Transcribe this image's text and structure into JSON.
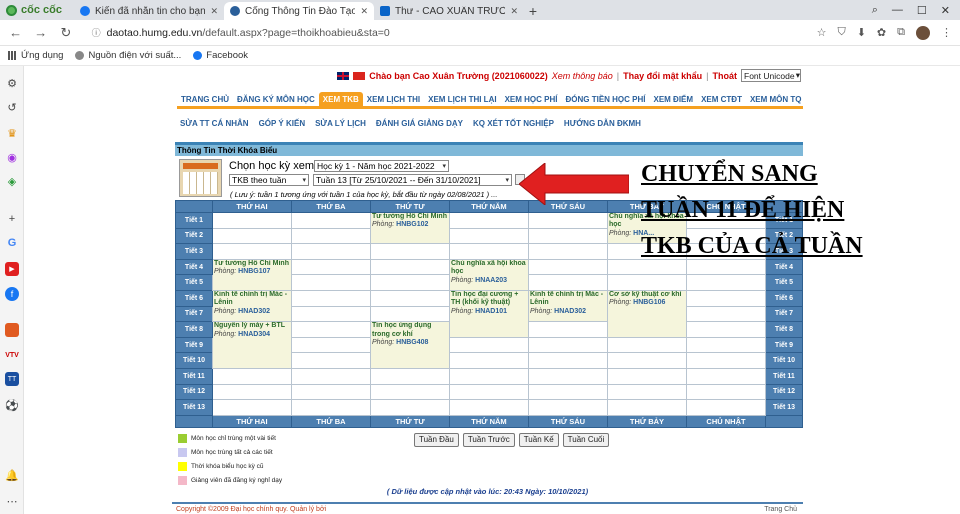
{
  "browser": {
    "brand": "cốc cốc",
    "tabs": [
      {
        "title": "Kiến đã nhắn tin cho bạn",
        "active": false
      },
      {
        "title": "Cổng Thông Tin Đào Tạo-Đạ",
        "active": true
      },
      {
        "title": "Thư - CAO XUÂN TRƯỜNG - ...",
        "active": false
      }
    ],
    "url_host": "daotao.humg.edu.vn",
    "url_path": "/default.aspx?page=thoikhoabieu&sta=0",
    "bookmarks": [
      "Ứng dụng",
      "Nguồn điện với suất...",
      "Facebook"
    ]
  },
  "header": {
    "greeting": "Chào bạn Cao Xuân Trường (2021060022)",
    "notice": "Xem thông báo",
    "change_password": "Thay đổi mật khẩu",
    "logout": "Thoát",
    "font_select": "Font Unicode"
  },
  "menu_primary": [
    "TRANG CHỦ",
    "ĐĂNG KÝ MÔN HỌC",
    "XEM TKB",
    "XEM LỊCH THI",
    "XEM LỊCH THI LẠI",
    "XEM HỌC PHÍ",
    "ĐÓNG TIỀN HỌC PHÍ",
    "XEM ĐIỂM",
    "XEM CTĐT",
    "XEM MÔN TQ"
  ],
  "menu_secondary": [
    "SỬA TT CÁ NHÂN",
    "GÓP Ý KIẾN",
    "SỬA LÝ LỊCH",
    "ĐÁNH GIÁ GIẢNG DẠY",
    "KQ XÉT TỐT NGHIỆP",
    "HƯỚNG DẪN ĐKMH"
  ],
  "panel": {
    "title": "Thông Tin Thời Khóa Biểu",
    "semester_label": "Chọn học kỳ xem TKB",
    "semester_value": "Học kỳ 1 - Năm học 2021-2022",
    "view_mode": "TKB theo tuần",
    "week_value": "Tuần 13 [Từ 25/10/2021 -- Đến 31/10/2021]",
    "note": "( Lưu ý: tuần 1 tương ứng với tuần 1 của học kỳ, bắt đầu từ ngày 02/08/2021 ) ..."
  },
  "schedule": {
    "days": [
      "THỨ HAI",
      "THỨ BA",
      "THỨ TƯ",
      "THỨ NĂM",
      "THỨ SÁU",
      "THỨ BẢY",
      "CHỦ NHẬT"
    ],
    "periods": [
      "Tiết 1",
      "Tiết 2",
      "Tiết 3",
      "Tiết 4",
      "Tiết 5",
      "Tiết 6",
      "Tiết 7",
      "Tiết 8",
      "Tiết 9",
      "Tiết 10",
      "Tiết 11",
      "Tiết 12",
      "Tiết 13"
    ],
    "room_label": "Phòng:",
    "classes": [
      {
        "day": 2,
        "start": 1,
        "span": 2,
        "subject": "Tư tưởng Hồ Chí Minh",
        "room": "HNBG102"
      },
      {
        "day": 5,
        "start": 1,
        "span": 2,
        "subject": "Chủ nghĩa xã hội khoa học",
        "room": "HNA..."
      },
      {
        "day": 0,
        "start": 4,
        "span": 2,
        "subject": "Tư tưởng Hồ Chí Minh",
        "room": "HNBG107"
      },
      {
        "day": 3,
        "start": 4,
        "span": 2,
        "subject": "Chủ nghĩa xã hội khoa học",
        "room": "HNAA203"
      },
      {
        "day": 0,
        "start": 6,
        "span": 2,
        "subject": "Kinh tế chính trị Mác - Lênin",
        "room": "HNAD302"
      },
      {
        "day": 3,
        "start": 6,
        "span": 3,
        "subject": "Tin học đại cương + TH (khối kỹ thuật)",
        "room": "HNAD101"
      },
      {
        "day": 4,
        "start": 6,
        "span": 2,
        "subject": "Kinh tế chính trị Mác - Lênin",
        "room": "HNAD302"
      },
      {
        "day": 5,
        "start": 6,
        "span": 3,
        "subject": "Cơ sở kỹ thuật cơ khí",
        "room": "HNBG106"
      },
      {
        "day": 0,
        "start": 8,
        "span": 3,
        "subject": "Nguyên lý máy + BTL",
        "room": "HNAD304"
      },
      {
        "day": 2,
        "start": 8,
        "span": 3,
        "subject": "Tin học ứng dụng trong cơ khí",
        "room": "HNBG408"
      }
    ]
  },
  "legend": [
    {
      "color": "#9acd32",
      "label": "Môn học chỉ trùng một vài tiết"
    },
    {
      "color": "#c8c8f0",
      "label": "Môn học trùng tất cả các tiết"
    },
    {
      "color": "#ffff00",
      "label": "Thời khóa biểu học kỳ cũ"
    },
    {
      "color": "#f4b8c8",
      "label": "Giảng viên đã đăng ký nghỉ dạy"
    }
  ],
  "week_nav": [
    "Tuần Đầu",
    "Tuần Trước",
    "Tuần Kế",
    "Tuần Cuối"
  ],
  "updated": "( Dữ liệu được cập nhật vào lúc: 20:43 Ngày: 10/10/2021)",
  "footer": {
    "copyright": "Copyright ©2009 Đại học chính quy. Quản lý bởi",
    "home": "Trang Chủ"
  },
  "annotation": {
    "lines": [
      "CHUYỂN SANG",
      "TUẦN 11 ĐỂ HIỆN",
      "TKB CỦA CẢ TUẦN"
    ],
    "arrow_color": "#e02020"
  }
}
